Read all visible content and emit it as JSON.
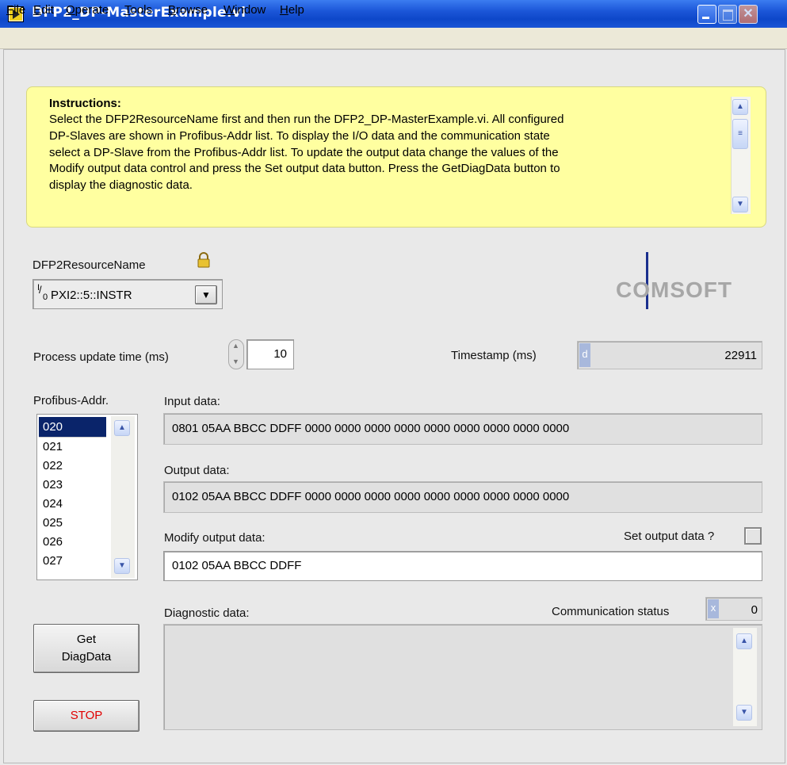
{
  "window": {
    "title": "DFP2_DP-MasterExample.vi"
  },
  "menu": [
    "File",
    "Edit",
    "Operate",
    "Tools",
    "Browse",
    "Window",
    "Help"
  ],
  "instructions": {
    "heading": "Instructions:",
    "lines": [
      "Select the DFP2ResourceName first and then run the DFP2_DP-MasterExample.vi. All configured",
      "DP-Slaves are shown in Profibus-Addr  list. To display the I/O data and the communication state",
      "select a DP-Slave from the Profibus-Addr list. To update the output data change the values of the",
      "Modify output data control and press the Set output data button. Press the GetDiagData button to",
      "display the diagnostic data."
    ]
  },
  "resource": {
    "label": "DFP2ResourceName",
    "io_glyph": "I/O",
    "value": "PXI2::5::INSTR"
  },
  "logo": {
    "text": "COMSOFT"
  },
  "process_update": {
    "label": "Process update time (ms)",
    "value": "10"
  },
  "timestamp": {
    "label": "Timestamp (ms)",
    "radix": "d",
    "value": "22911"
  },
  "profibus": {
    "label": "Profibus-Addr.",
    "items": [
      "020",
      "021",
      "022",
      "023",
      "024",
      "025",
      "026",
      "027"
    ],
    "selected_index": 0
  },
  "input_data": {
    "label": "Input data:",
    "value": "0801 05AA BBCC DDFF 0000 0000 0000 0000 0000 0000 0000 0000 0000"
  },
  "output_data": {
    "label": "Output data:",
    "value": "0102 05AA BBCC DDFF 0000 0000 0000 0000 0000 0000 0000 0000 0000"
  },
  "modify_output": {
    "label": "Modify output data:",
    "value": "0102 05AA BBCC DDFF"
  },
  "set_output": {
    "label": "Set output data ?"
  },
  "diagnostic": {
    "label": "Diagnostic data:",
    "value": ""
  },
  "comm_status": {
    "label": "Communication status",
    "radix": "x",
    "value": "0"
  },
  "buttons": {
    "get_diag": "Get\nDiagData",
    "stop": "STOP"
  },
  "colors": {
    "titlebar": "#0d47c9",
    "instructions_bg": "#ffffa0",
    "selected_item": "#0a246a",
    "stop_text": "#e00000",
    "panel_bg": "#e9e9e9"
  }
}
